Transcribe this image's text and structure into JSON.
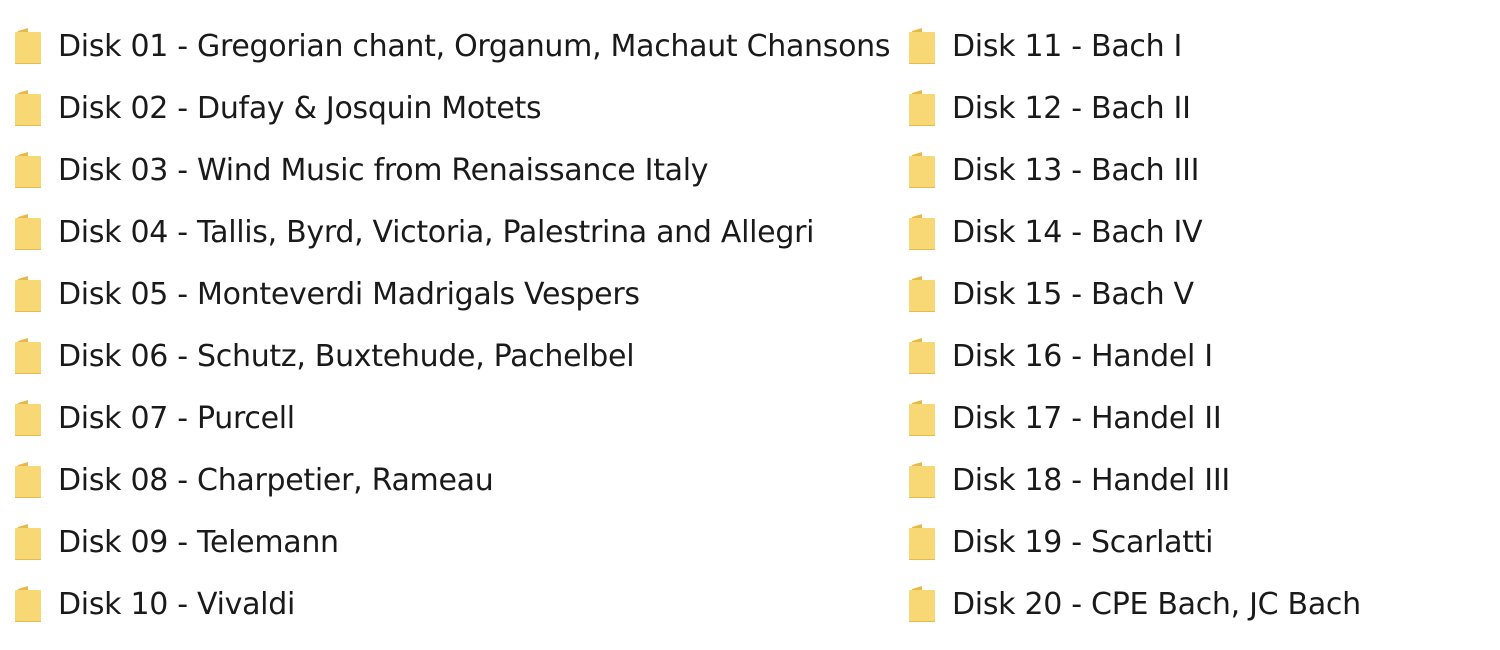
{
  "folders": {
    "left": [
      {
        "name": "Disk 01 - Gregorian chant, Organum, Machaut Chansons",
        "icon": "folder-icon"
      },
      {
        "name": "Disk 02 - Dufay & Josquin Motets",
        "icon": "folder-icon"
      },
      {
        "name": "Disk 03 - Wind Music from Renaissance Italy",
        "icon": "folder-icon"
      },
      {
        "name": "Disk 04 - Tallis, Byrd, Victoria, Palestrina and Allegri",
        "icon": "folder-icon"
      },
      {
        "name": "Disk 05 - Monteverdi Madrigals  Vespers",
        "icon": "folder-icon"
      },
      {
        "name": "Disk 06 - Schutz, Buxtehude, Pachelbel",
        "icon": "folder-icon"
      },
      {
        "name": "Disk 07 - Purcell",
        "icon": "folder-icon"
      },
      {
        "name": "Disk 08 - Charpetier, Rameau",
        "icon": "folder-icon"
      },
      {
        "name": "Disk 09 - Telemann",
        "icon": "folder-icon"
      },
      {
        "name": "Disk 10 - Vivaldi",
        "icon": "folder-icon"
      }
    ],
    "right": [
      {
        "name": "Disk 11 - Bach I",
        "icon": "folder-icon"
      },
      {
        "name": "Disk 12 - Bach II",
        "icon": "folder-icon"
      },
      {
        "name": "Disk 13 - Bach III",
        "icon": "folder-icon"
      },
      {
        "name": "Disk 14 - Bach IV",
        "icon": "folder-icon"
      },
      {
        "name": "Disk 15 - Bach V",
        "icon": "folder-icon"
      },
      {
        "name": "Disk 16 - Handel I",
        "icon": "folder-icon"
      },
      {
        "name": "Disk 17 - Handel II",
        "icon": "folder-icon"
      },
      {
        "name": "Disk 18 - Handel III",
        "icon": "folder-icon"
      },
      {
        "name": "Disk 19 - Scarlatti",
        "icon": "folder-icon"
      },
      {
        "name": "Disk 20 - CPE Bach, JC Bach",
        "icon": "folder-icon"
      }
    ]
  },
  "colors": {
    "folder_front": "#F8D775",
    "folder_back": "#E8B84A",
    "folder_edge": "#D9A636",
    "text": "#1a1a1a",
    "background": "#ffffff"
  }
}
